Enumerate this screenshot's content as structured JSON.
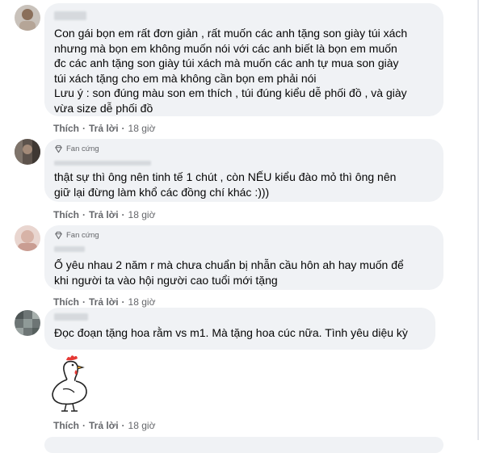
{
  "comments": [
    {
      "text": "Con gái bọn em rất đơn giản , rất muốn các anh tặng son giày túi xách\nnhưng mà bọn em không muốn nói với các anh biết là bọn em muốn\nđc các anh tặng son giày túi xách mà muốn các anh tự mua son giày\ntúi xách tặng cho em mà không cần bọn em phải nói\nLưu ý : son đúng màu son em thích , túi đúng kiểu dễ phối đồ , và giày\nvừa size dễ phối đồ",
      "like": "Thích",
      "reply": "Trả lời",
      "time": "18 giờ"
    },
    {
      "badge": "Fan cứng",
      "text": "thật sự thì ông nên tinh tế 1 chút , còn NẾU kiểu đào mỏ thì ông nên\ngiữ lại đừng làm khổ các đồng chí khác :)))",
      "like": "Thích",
      "reply": "Trả lời",
      "time": "18 giờ"
    },
    {
      "badge": "Fan cứng",
      "text": "Ố yêu nhau 2 năm r mà chưa chuẩn bị nhẫn cầu hôn ah hay muốn để\nkhi người ta vào hội người cao tuổi mới tặng",
      "like": "Thích",
      "reply": "Trả lời",
      "time": "18 giờ"
    },
    {
      "text": "Đọc đoạn tặng hoa rằm vs m1. Mà tặng hoa cúc nữa. Tình yêu diệu kỳ",
      "sticker": "chicken-sticker",
      "like": "Thích",
      "reply": "Trả lời",
      "time": "18 giờ"
    }
  ],
  "colors": {
    "bubble": "#f0f2f5",
    "meta": "#65676b",
    "text": "#050505"
  }
}
